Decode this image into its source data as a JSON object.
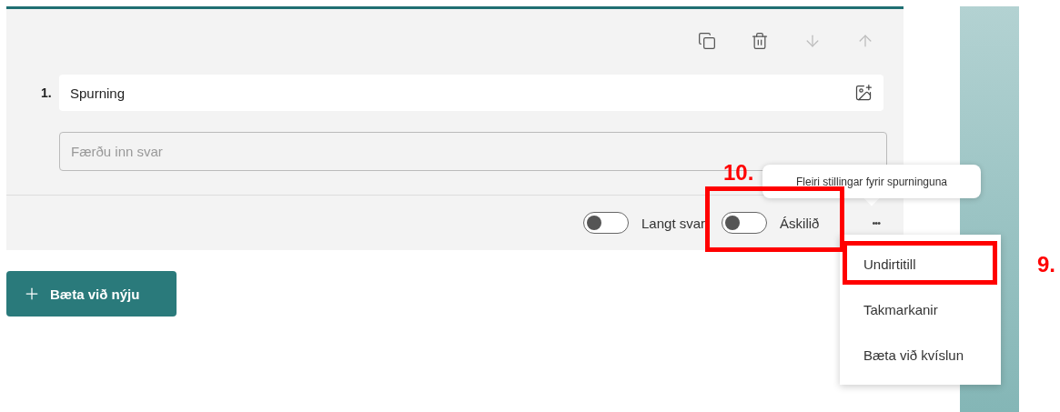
{
  "question": {
    "number": "1.",
    "title": "Spurning",
    "answer_placeholder": "Færðu inn svar"
  },
  "toggles": [
    {
      "label": "Langt svar",
      "on": false
    },
    {
      "label": "Áskilið",
      "on": false
    }
  ],
  "more_button": "•••",
  "tooltip": "Fleiri stillingar fyrir spurninguna",
  "menu": [
    {
      "label": "Undirtitill"
    },
    {
      "label": "Takmarkanir"
    },
    {
      "label": "Bæta við kvíslun"
    }
  ],
  "add_button": "Bæta við nýju",
  "annotations": [
    {
      "label": "10."
    },
    {
      "label": "9."
    }
  ]
}
